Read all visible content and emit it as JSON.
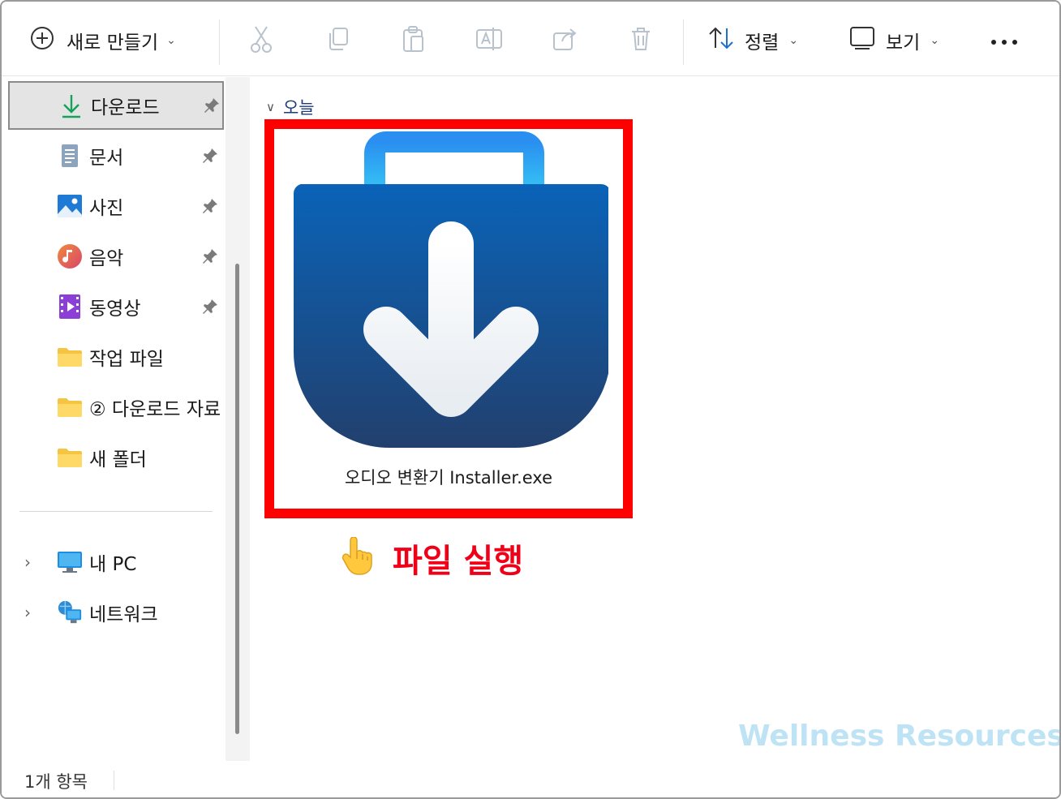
{
  "toolbar": {
    "new_label": "새로 만들기",
    "sort_label": "정렬",
    "view_label": "보기"
  },
  "sidebar": {
    "quick_access": [
      {
        "label": "다운로드",
        "icon": "download-icon",
        "pinned": true,
        "selected": true
      },
      {
        "label": "문서",
        "icon": "document-icon",
        "pinned": true
      },
      {
        "label": "사진",
        "icon": "pictures-icon",
        "pinned": true
      },
      {
        "label": "음악",
        "icon": "music-icon",
        "pinned": true
      },
      {
        "label": "동영상",
        "icon": "video-icon",
        "pinned": true
      },
      {
        "label": "작업 파일",
        "icon": "folder-icon"
      },
      {
        "label": "② 다운로드 자료",
        "icon": "folder-icon"
      },
      {
        "label": "새 폴더",
        "icon": "folder-icon"
      }
    ],
    "locations": [
      {
        "label": "내 PC",
        "icon": "pc-icon"
      },
      {
        "label": "네트워크",
        "icon": "network-icon"
      }
    ]
  },
  "main": {
    "group_header": "오늘",
    "file": {
      "name": "오디오 변환기 Installer.exe",
      "icon": "installer-bag-icon"
    },
    "callout_text": "파일 실행",
    "watermark": "Wellness Resources"
  },
  "status": {
    "item_count": "1개 항목"
  },
  "colors": {
    "highlight_border": "#ff0000",
    "callout_text": "#f00018",
    "bag_top": "#0a63b8",
    "bag_bottom": "#22406e",
    "watermark": "#bde3f5"
  }
}
